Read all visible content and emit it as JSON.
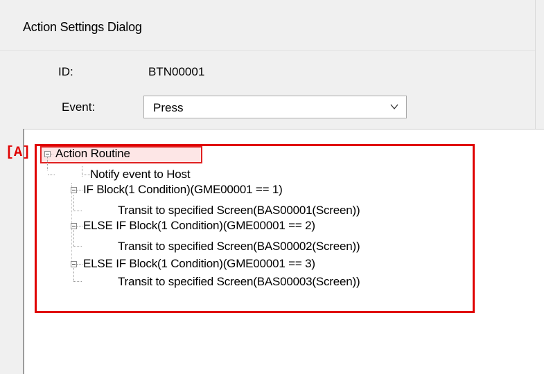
{
  "dialog": {
    "title": "Action Settings Dialog",
    "id_label": "ID:",
    "id_value": "BTN00001",
    "event_label": "Event:",
    "event_select": {
      "value": "Press",
      "icon": "chevron-down-icon"
    }
  },
  "tree": {
    "root": "Action Routine",
    "nodes": [
      "Notify event to Host",
      "IF Block(1 Condition)(GME00001 == 1)",
      "Transit to specified Screen(BAS00001(Screen))",
      "ELSE IF Block(1 Condition)(GME00001 == 2)",
      "Transit to specified Screen(BAS00002(Screen))",
      "ELSE IF Block(1 Condition)(GME00001 == 3)",
      "Transit to specified Screen(BAS00003(Screen))"
    ]
  },
  "annotation": {
    "label": "[A]",
    "color": "#e00000"
  }
}
